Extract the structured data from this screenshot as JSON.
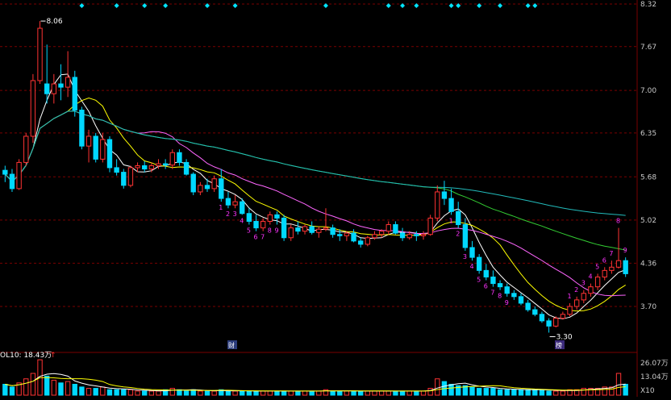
{
  "chart_data": [
    {
      "type": "candlestick",
      "title": "",
      "y_ticks": [
        "8.32",
        "7.67",
        "7.00",
        "6.35",
        "5.68",
        "5.02",
        "4.36",
        "3.70"
      ],
      "ylim": [
        3.3,
        8.32
      ],
      "high_label": "8.06",
      "low_label": "3.30",
      "marker_labels": [
        "财",
        "榜"
      ],
      "seq_labels": [
        "1",
        "2",
        "3",
        "4",
        "5",
        "6",
        "7",
        "8",
        "9",
        "1",
        "2",
        "3",
        "4",
        "5",
        "6",
        "7",
        "8",
        "9",
        "1",
        "2",
        "3",
        "4",
        "5",
        "6",
        "7",
        "8",
        "9"
      ],
      "colors": {
        "up": "#ff3333",
        "down": "#00d8ff",
        "ma5": "#ffffff",
        "ma10": "#ffff00",
        "ma20": "#ff66ff",
        "ma60": "#33cc33",
        "ma120": "#22bbbb",
        "grid": "#7a0000",
        "dots": "#00e5ff",
        "seq": "#ff33ff"
      },
      "candles": [
        [
          5.78,
          5.85,
          5.6,
          5.72
        ],
        [
          5.72,
          5.8,
          5.45,
          5.5
        ],
        [
          5.5,
          5.95,
          5.48,
          5.9
        ],
        [
          5.9,
          6.35,
          5.85,
          6.3
        ],
        [
          6.3,
          7.25,
          6.2,
          7.15
        ],
        [
          7.15,
          8.06,
          7.1,
          7.95
        ],
        [
          7.1,
          7.7,
          6.8,
          6.95
        ],
        [
          6.95,
          7.25,
          6.8,
          7.1
        ],
        [
          7.1,
          7.4,
          6.85,
          7.05
        ],
        [
          7.05,
          7.6,
          6.9,
          7.2
        ],
        [
          7.2,
          7.3,
          6.6,
          6.7
        ],
        [
          6.7,
          6.75,
          6.1,
          6.15
        ],
        [
          6.15,
          6.4,
          5.9,
          6.3
        ],
        [
          6.3,
          6.35,
          5.9,
          5.95
        ],
        [
          5.95,
          6.35,
          5.9,
          6.25
        ],
        [
          6.25,
          6.3,
          5.75,
          5.82
        ],
        [
          5.82,
          5.95,
          5.7,
          5.75
        ],
        [
          5.75,
          5.8,
          5.5,
          5.55
        ],
        [
          5.55,
          5.85,
          5.52,
          5.82
        ],
        [
          5.82,
          5.9,
          5.75,
          5.85
        ],
        [
          5.85,
          5.92,
          5.75,
          5.8
        ],
        [
          5.8,
          5.9,
          5.75,
          5.85
        ],
        [
          5.85,
          5.95,
          5.8,
          5.88
        ],
        [
          5.88,
          5.95,
          5.8,
          5.86
        ],
        [
          5.86,
          6.1,
          5.8,
          6.05
        ],
        [
          6.05,
          6.1,
          5.85,
          5.9
        ],
        [
          5.9,
          5.95,
          5.7,
          5.72
        ],
        [
          5.72,
          5.75,
          5.4,
          5.45
        ],
        [
          5.45,
          5.6,
          5.4,
          5.55
        ],
        [
          5.55,
          5.65,
          5.45,
          5.5
        ],
        [
          5.5,
          5.7,
          5.45,
          5.65
        ],
        [
          5.65,
          5.8,
          5.3,
          5.35
        ],
        [
          5.35,
          5.45,
          5.2,
          5.25
        ],
        [
          5.25,
          5.4,
          5.2,
          5.3
        ],
        [
          5.3,
          5.35,
          5.1,
          5.12
        ],
        [
          5.12,
          5.2,
          4.95,
          5.0
        ],
        [
          5.0,
          5.1,
          4.85,
          4.9
        ],
        [
          4.9,
          5.05,
          4.85,
          5.0
        ],
        [
          5.0,
          5.15,
          4.95,
          5.1
        ],
        [
          5.1,
          5.15,
          4.95,
          5.05
        ],
        [
          5.05,
          5.1,
          4.7,
          4.75
        ],
        [
          4.75,
          4.95,
          4.7,
          4.9
        ],
        [
          4.9,
          5.0,
          4.8,
          4.85
        ],
        [
          4.85,
          4.95,
          4.8,
          4.92
        ],
        [
          4.92,
          5.0,
          4.8,
          4.83
        ],
        [
          4.83,
          4.92,
          4.75,
          4.88
        ],
        [
          4.88,
          5.2,
          4.85,
          4.9
        ],
        [
          4.9,
          4.95,
          4.75,
          4.8
        ],
        [
          4.8,
          4.88,
          4.7,
          4.78
        ],
        [
          4.78,
          4.85,
          4.7,
          4.82
        ],
        [
          4.82,
          4.88,
          4.68,
          4.7
        ],
        [
          4.7,
          4.75,
          4.6,
          4.65
        ],
        [
          4.65,
          4.78,
          4.62,
          4.75
        ],
        [
          4.75,
          4.85,
          4.72,
          4.8
        ],
        [
          4.8,
          4.88,
          4.75,
          4.85
        ],
        [
          4.85,
          5.0,
          4.8,
          4.95
        ],
        [
          4.95,
          5.0,
          4.8,
          4.82
        ],
        [
          4.82,
          4.9,
          4.7,
          4.75
        ],
        [
          4.75,
          4.85,
          4.72,
          4.8
        ],
        [
          4.8,
          4.85,
          4.7,
          4.78
        ],
        [
          4.78,
          4.85,
          4.72,
          4.8
        ],
        [
          4.8,
          5.1,
          4.78,
          5.05
        ],
        [
          5.05,
          5.55,
          5.0,
          5.45
        ],
        [
          5.45,
          5.62,
          5.25,
          5.35
        ],
        [
          5.35,
          5.5,
          5.1,
          5.15
        ],
        [
          5.15,
          5.3,
          4.9,
          4.95
        ],
        [
          4.95,
          5.05,
          4.55,
          4.6
        ],
        [
          4.6,
          4.7,
          4.4,
          4.45
        ],
        [
          4.45,
          4.5,
          4.2,
          4.25
        ],
        [
          4.25,
          4.35,
          4.1,
          4.15
        ],
        [
          4.15,
          4.25,
          4.0,
          4.05
        ],
        [
          4.05,
          4.1,
          3.95,
          4.0
        ],
        [
          4.0,
          4.05,
          3.85,
          3.9
        ],
        [
          3.9,
          3.95,
          3.8,
          3.85
        ],
        [
          3.85,
          3.9,
          3.72,
          3.75
        ],
        [
          3.75,
          3.8,
          3.62,
          3.65
        ],
        [
          3.65,
          3.7,
          3.55,
          3.58
        ],
        [
          3.58,
          3.62,
          3.45,
          3.48
        ],
        [
          3.48,
          3.52,
          3.3,
          3.4
        ],
        [
          3.4,
          3.55,
          3.38,
          3.52
        ],
        [
          3.52,
          3.62,
          3.5,
          3.58
        ],
        [
          3.58,
          3.75,
          3.55,
          3.7
        ],
        [
          3.7,
          3.85,
          3.65,
          3.8
        ],
        [
          3.8,
          3.95,
          3.75,
          3.9
        ],
        [
          3.9,
          4.05,
          3.85,
          4.0
        ],
        [
          4.0,
          4.2,
          3.95,
          4.15
        ],
        [
          4.15,
          4.3,
          4.1,
          4.25
        ],
        [
          4.25,
          4.4,
          4.2,
          4.3
        ],
        [
          4.3,
          4.9,
          4.28,
          4.4
        ],
        [
          4.4,
          4.45,
          4.15,
          4.2
        ]
      ],
      "volume_axis_labels": [
        "26.07万",
        "13.04万",
        "X10"
      ],
      "vol_label": "OL10: 18.43万",
      "vol_arrow": "↑",
      "volume_values": [
        8,
        6,
        9,
        12,
        16,
        26,
        14,
        11,
        9,
        10,
        8,
        6,
        5,
        5,
        6,
        4,
        4,
        4,
        4,
        3,
        3,
        3,
        3,
        4,
        5,
        4,
        3,
        4,
        3,
        3,
        3,
        4,
        3,
        3,
        3,
        3,
        3,
        3,
        3,
        3,
        3,
        3,
        3,
        3,
        3,
        3,
        4,
        3,
        3,
        3,
        3,
        3,
        3,
        3,
        3,
        3,
        3,
        3,
        3,
        3,
        3,
        5,
        12,
        10,
        8,
        7,
        7,
        6,
        5,
        5,
        5,
        4,
        4,
        4,
        4,
        4,
        4,
        4,
        3,
        3,
        3,
        4,
        4,
        5,
        5,
        5,
        6,
        6,
        16,
        8
      ]
    }
  ]
}
